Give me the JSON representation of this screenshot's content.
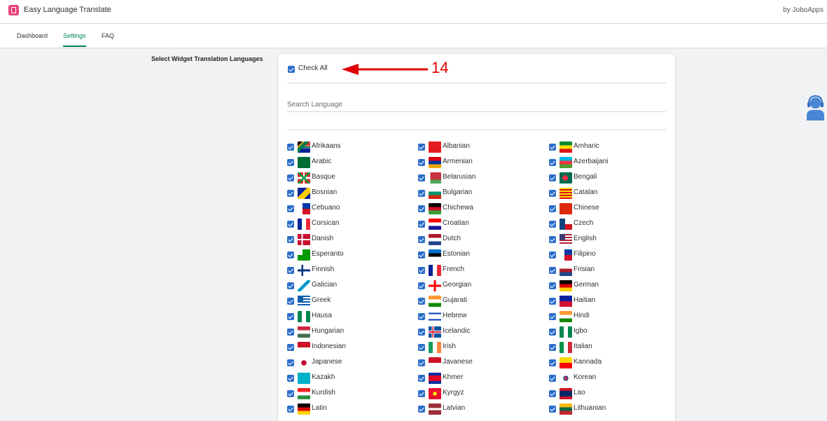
{
  "app": {
    "title": "Easy Language Translate",
    "brand": "by JoboApps"
  },
  "nav": {
    "tabs": [
      {
        "label": "Dashboard"
      },
      {
        "label": "Settings"
      },
      {
        "label": "FAQ"
      }
    ]
  },
  "section": {
    "label": "Select Widget Translation Languages"
  },
  "widget": {
    "check_all_label": "Check All",
    "search_placeholder": "Search Language",
    "search_value": ""
  },
  "annotation": {
    "number": "14",
    "color": "#e00000"
  },
  "colors": {
    "accent": "#008060",
    "checkbox": "#2c6ecb"
  },
  "languages": [
    {
      "name": "Afrikaans",
      "checked": true
    },
    {
      "name": "Albanian",
      "checked": true
    },
    {
      "name": "Amharic",
      "checked": true
    },
    {
      "name": "Arabic",
      "checked": true
    },
    {
      "name": "Armenian",
      "checked": true
    },
    {
      "name": "Azerbaijani",
      "checked": true
    },
    {
      "name": "Basque",
      "checked": true
    },
    {
      "name": "Belarusian",
      "checked": true
    },
    {
      "name": "Bengali",
      "checked": true
    },
    {
      "name": "Bosnian",
      "checked": true
    },
    {
      "name": "Bulgarian",
      "checked": true
    },
    {
      "name": "Catalan",
      "checked": true
    },
    {
      "name": "Cebuano",
      "checked": true
    },
    {
      "name": "Chichewa",
      "checked": true
    },
    {
      "name": "Chinese",
      "checked": true
    },
    {
      "name": "Corsican",
      "checked": true
    },
    {
      "name": "Croatian",
      "checked": true
    },
    {
      "name": "Czech",
      "checked": true
    },
    {
      "name": "Danish",
      "checked": true
    },
    {
      "name": "Dutch",
      "checked": true
    },
    {
      "name": "English",
      "checked": true
    },
    {
      "name": "Esperanto",
      "checked": true
    },
    {
      "name": "Estonian",
      "checked": true
    },
    {
      "name": "Filipino",
      "checked": true
    },
    {
      "name": "Finnish",
      "checked": true
    },
    {
      "name": "French",
      "checked": true
    },
    {
      "name": "Frisian",
      "checked": true
    },
    {
      "name": "Galician",
      "checked": true
    },
    {
      "name": "Georgian",
      "checked": true
    },
    {
      "name": "German",
      "checked": true
    },
    {
      "name": "Greek",
      "checked": true
    },
    {
      "name": "Gujarati",
      "checked": true
    },
    {
      "name": "Haitian",
      "checked": true
    },
    {
      "name": "Hausa",
      "checked": true
    },
    {
      "name": "Hebrew",
      "checked": true
    },
    {
      "name": "Hindi",
      "checked": true
    },
    {
      "name": "Hungarian",
      "checked": true
    },
    {
      "name": "Icelandic",
      "checked": true
    },
    {
      "name": "Igbo",
      "checked": true
    },
    {
      "name": "Indonesian",
      "checked": true
    },
    {
      "name": "Irish",
      "checked": true
    },
    {
      "name": "Italian",
      "checked": true
    },
    {
      "name": "Japanese",
      "checked": true
    },
    {
      "name": "Javanese",
      "checked": true
    },
    {
      "name": "Kannada",
      "checked": true
    },
    {
      "name": "Kazakh",
      "checked": true
    },
    {
      "name": "Khmer",
      "checked": true
    },
    {
      "name": "Korean",
      "checked": true
    },
    {
      "name": "Kurdish",
      "checked": true
    },
    {
      "name": "Kyrgyz",
      "checked": true
    },
    {
      "name": "Lao",
      "checked": true
    },
    {
      "name": "Latin",
      "checked": true
    },
    {
      "name": "Latvian",
      "checked": true
    },
    {
      "name": "Lithuanian",
      "checked": true
    }
  ]
}
